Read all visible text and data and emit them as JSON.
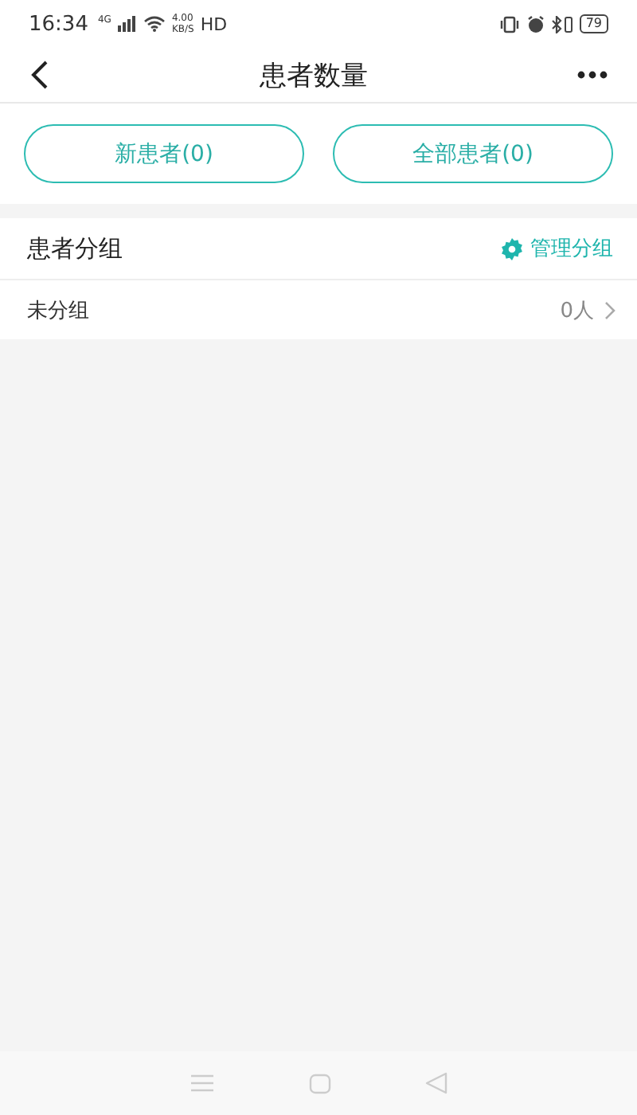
{
  "status_bar": {
    "time": "16:34",
    "network": "4G",
    "speed": "4.00",
    "speed_unit": "KB/S",
    "hd": "HD",
    "battery": "79"
  },
  "header": {
    "title": "患者数量"
  },
  "buttons": [
    {
      "label": "新患者(0)"
    },
    {
      "label": "全部患者(0)"
    }
  ],
  "groups": {
    "title": "患者分组",
    "manage": "管理分组",
    "rows": [
      {
        "name": "未分组",
        "count": "0人"
      }
    ]
  }
}
